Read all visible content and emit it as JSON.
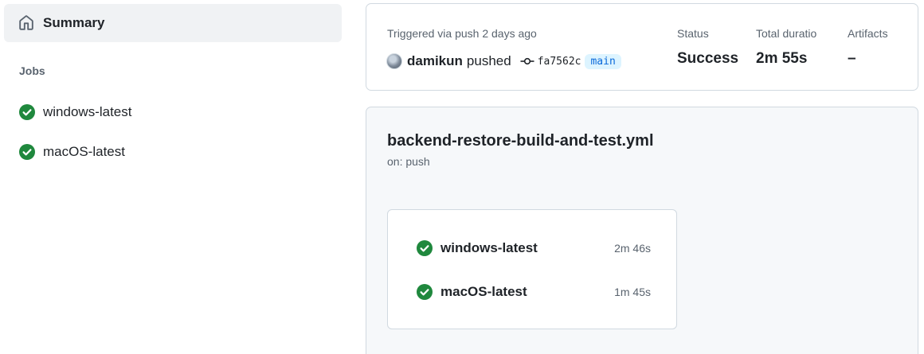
{
  "sidebar": {
    "summary_label": "Summary",
    "jobs_heading": "Jobs",
    "jobs": [
      {
        "label": "windows-latest",
        "status": "success"
      },
      {
        "label": "macOS-latest",
        "status": "success"
      }
    ]
  },
  "run": {
    "trigger_text": "Triggered via push 2 days ago",
    "actor": "damikun",
    "action": "pushed",
    "commit_sha": "fa7562c",
    "branch": "main",
    "stats": [
      {
        "label": "Status",
        "value": "Success"
      },
      {
        "label": "Total duratio",
        "value": "2m 55s"
      },
      {
        "label": "Artifacts",
        "value": "–"
      }
    ]
  },
  "workflow": {
    "file": "backend-restore-build-and-test.yml",
    "trigger": "on: push",
    "jobs": [
      {
        "name": "windows-latest",
        "duration": "2m 46s"
      },
      {
        "name": "macOS-latest",
        "duration": "1m 45s"
      }
    ]
  },
  "colors": {
    "success": "#1a7f37",
    "branch_bg": "#ddf4ff",
    "branch_fg": "#0969da",
    "muted": "#59636e"
  },
  "icons": {
    "summary": "home-icon",
    "job_status": "check-circle-fill-icon",
    "commit": "git-commit-icon"
  }
}
